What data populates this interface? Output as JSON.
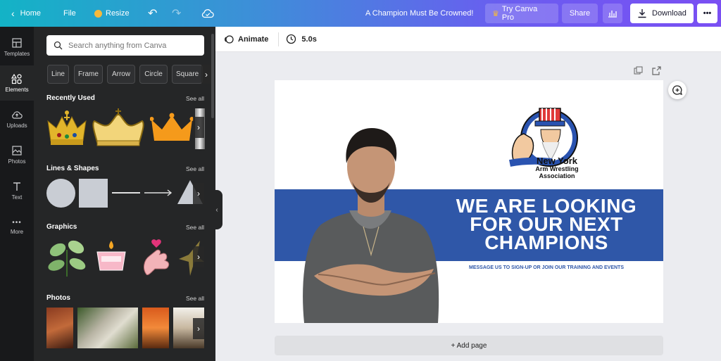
{
  "topbar": {
    "home": "Home",
    "file": "File",
    "resize": "Resize",
    "doc_title": "A Champion Must Be Crowned!",
    "try_pro": "Try Canva Pro",
    "share": "Share",
    "download": "Download"
  },
  "rail": {
    "items": [
      {
        "label": "Templates",
        "icon": "templates-icon"
      },
      {
        "label": "Elements",
        "icon": "elements-icon"
      },
      {
        "label": "Uploads",
        "icon": "uploads-icon"
      },
      {
        "label": "Photos",
        "icon": "photos-icon"
      },
      {
        "label": "Text",
        "icon": "text-icon"
      },
      {
        "label": "More",
        "icon": "more-icon"
      }
    ]
  },
  "panel": {
    "search_placeholder": "Search anything from Canva",
    "chips": [
      "Line",
      "Frame",
      "Arrow",
      "Circle",
      "Square"
    ],
    "sections": [
      {
        "title": "Recently Used",
        "see_all": "See all"
      },
      {
        "title": "Lines & Shapes",
        "see_all": "See all"
      },
      {
        "title": "Graphics",
        "see_all": "See all"
      },
      {
        "title": "Photos",
        "see_all": "See all"
      }
    ]
  },
  "toolbar": {
    "animate": "Animate",
    "duration": "5.0s"
  },
  "design": {
    "logo_text": [
      "New York",
      "Arm Wrestling",
      "Association"
    ],
    "headline": [
      "WE ARE LOOKING",
      "FOR OUR NEXT",
      "CHAMPIONS"
    ],
    "subline": "MESSAGE US TO SIGN-UP OR JOIN OUR TRAINING AND EVENTS"
  },
  "add_page": "+ Add page",
  "colors": {
    "accent_blue": "#2f57a8",
    "panel_bg": "#252627",
    "rail_bg": "#18191b"
  }
}
